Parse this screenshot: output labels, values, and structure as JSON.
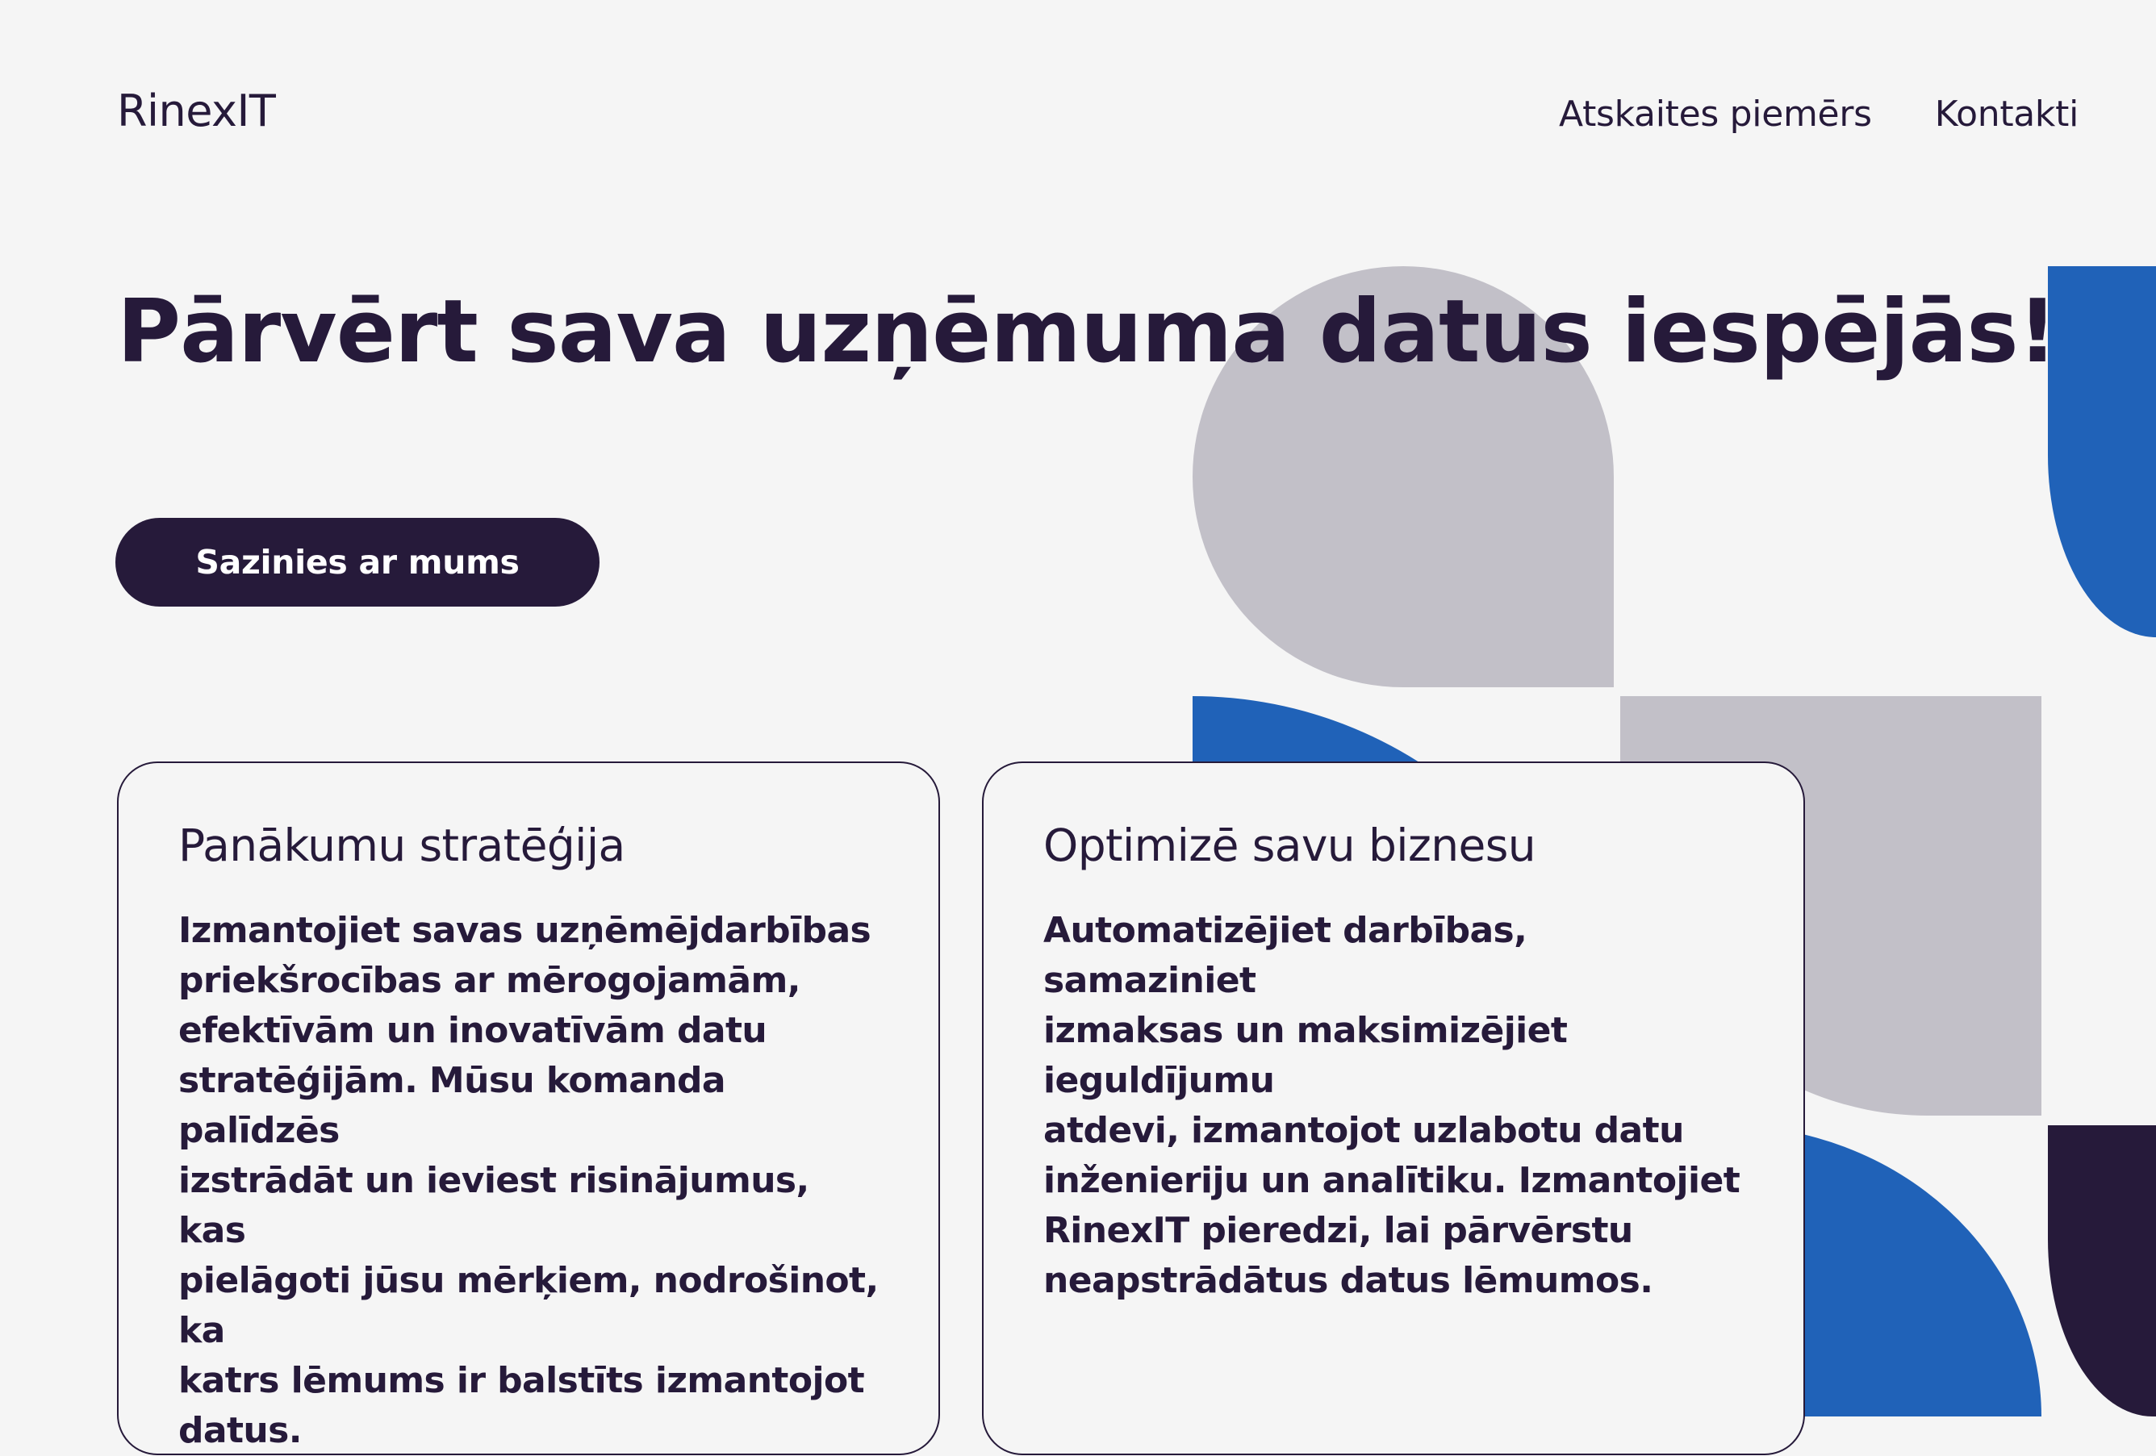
{
  "header": {
    "logo": "RinexIT",
    "nav": [
      {
        "label": "Atskaites piemērs"
      },
      {
        "label": "Kontakti"
      }
    ]
  },
  "hero": {
    "title": "Pārvērt sava uzņēmuma datus iespējās!",
    "cta_label": "Sazinies ar mums"
  },
  "cards": [
    {
      "title": "Panākumu stratēģija",
      "text": "Izmantojiet savas uzņēmējdarbības\npriekšrocības ar mērogojamām,\nefektīvām un inovatīvām datu\nstratēģijām. Mūsu komanda palīdzēs\nizstrādāt un ieviest risinājumus, kas\npielāgoti jūsu mērķiem, nodrošinot, ka\nkatrs lēmums ir balstīts izmantojot\ndatus."
    },
    {
      "title": "Optimizē savu biznesu",
      "text": "Automatizējiet darbības, samaziniet\nizmaksas un maksimizējiet ieguldījumu\natdevi, izmantojot uzlabotu datu\ninženieriju un analītiku. Izmantojiet\nRinexIT pieredzi, lai pārvērstu\nneapstrādātus datus lēmumos."
    }
  ],
  "colors": {
    "dark": "#261a3a",
    "blue": "#2062b8",
    "gray": "#c2c0c8",
    "background": "#f5f5f5"
  }
}
